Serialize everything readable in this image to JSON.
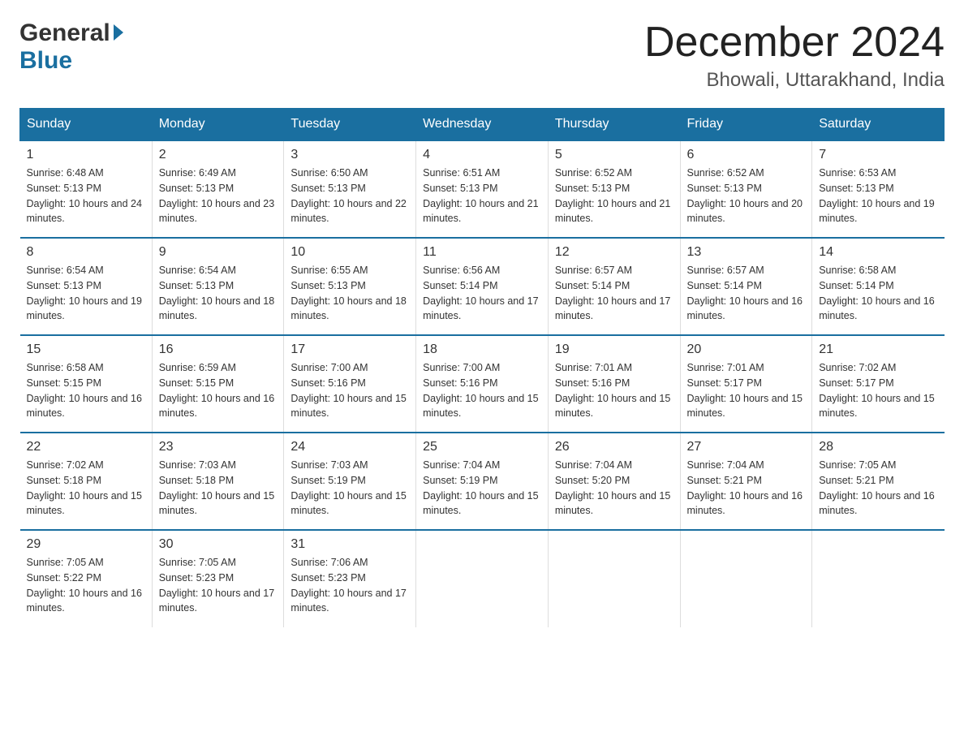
{
  "header": {
    "logo_general": "General",
    "logo_blue": "Blue",
    "month_title": "December 2024",
    "location": "Bhowali, Uttarakhand, India"
  },
  "columns": [
    "Sunday",
    "Monday",
    "Tuesday",
    "Wednesday",
    "Thursday",
    "Friday",
    "Saturday"
  ],
  "weeks": [
    [
      {
        "day": "1",
        "sunrise": "Sunrise: 6:48 AM",
        "sunset": "Sunset: 5:13 PM",
        "daylight": "Daylight: 10 hours and 24 minutes."
      },
      {
        "day": "2",
        "sunrise": "Sunrise: 6:49 AM",
        "sunset": "Sunset: 5:13 PM",
        "daylight": "Daylight: 10 hours and 23 minutes."
      },
      {
        "day": "3",
        "sunrise": "Sunrise: 6:50 AM",
        "sunset": "Sunset: 5:13 PM",
        "daylight": "Daylight: 10 hours and 22 minutes."
      },
      {
        "day": "4",
        "sunrise": "Sunrise: 6:51 AM",
        "sunset": "Sunset: 5:13 PM",
        "daylight": "Daylight: 10 hours and 21 minutes."
      },
      {
        "day": "5",
        "sunrise": "Sunrise: 6:52 AM",
        "sunset": "Sunset: 5:13 PM",
        "daylight": "Daylight: 10 hours and 21 minutes."
      },
      {
        "day": "6",
        "sunrise": "Sunrise: 6:52 AM",
        "sunset": "Sunset: 5:13 PM",
        "daylight": "Daylight: 10 hours and 20 minutes."
      },
      {
        "day": "7",
        "sunrise": "Sunrise: 6:53 AM",
        "sunset": "Sunset: 5:13 PM",
        "daylight": "Daylight: 10 hours and 19 minutes."
      }
    ],
    [
      {
        "day": "8",
        "sunrise": "Sunrise: 6:54 AM",
        "sunset": "Sunset: 5:13 PM",
        "daylight": "Daylight: 10 hours and 19 minutes."
      },
      {
        "day": "9",
        "sunrise": "Sunrise: 6:54 AM",
        "sunset": "Sunset: 5:13 PM",
        "daylight": "Daylight: 10 hours and 18 minutes."
      },
      {
        "day": "10",
        "sunrise": "Sunrise: 6:55 AM",
        "sunset": "Sunset: 5:13 PM",
        "daylight": "Daylight: 10 hours and 18 minutes."
      },
      {
        "day": "11",
        "sunrise": "Sunrise: 6:56 AM",
        "sunset": "Sunset: 5:14 PM",
        "daylight": "Daylight: 10 hours and 17 minutes."
      },
      {
        "day": "12",
        "sunrise": "Sunrise: 6:57 AM",
        "sunset": "Sunset: 5:14 PM",
        "daylight": "Daylight: 10 hours and 17 minutes."
      },
      {
        "day": "13",
        "sunrise": "Sunrise: 6:57 AM",
        "sunset": "Sunset: 5:14 PM",
        "daylight": "Daylight: 10 hours and 16 minutes."
      },
      {
        "day": "14",
        "sunrise": "Sunrise: 6:58 AM",
        "sunset": "Sunset: 5:14 PM",
        "daylight": "Daylight: 10 hours and 16 minutes."
      }
    ],
    [
      {
        "day": "15",
        "sunrise": "Sunrise: 6:58 AM",
        "sunset": "Sunset: 5:15 PM",
        "daylight": "Daylight: 10 hours and 16 minutes."
      },
      {
        "day": "16",
        "sunrise": "Sunrise: 6:59 AM",
        "sunset": "Sunset: 5:15 PM",
        "daylight": "Daylight: 10 hours and 16 minutes."
      },
      {
        "day": "17",
        "sunrise": "Sunrise: 7:00 AM",
        "sunset": "Sunset: 5:16 PM",
        "daylight": "Daylight: 10 hours and 15 minutes."
      },
      {
        "day": "18",
        "sunrise": "Sunrise: 7:00 AM",
        "sunset": "Sunset: 5:16 PM",
        "daylight": "Daylight: 10 hours and 15 minutes."
      },
      {
        "day": "19",
        "sunrise": "Sunrise: 7:01 AM",
        "sunset": "Sunset: 5:16 PM",
        "daylight": "Daylight: 10 hours and 15 minutes."
      },
      {
        "day": "20",
        "sunrise": "Sunrise: 7:01 AM",
        "sunset": "Sunset: 5:17 PM",
        "daylight": "Daylight: 10 hours and 15 minutes."
      },
      {
        "day": "21",
        "sunrise": "Sunrise: 7:02 AM",
        "sunset": "Sunset: 5:17 PM",
        "daylight": "Daylight: 10 hours and 15 minutes."
      }
    ],
    [
      {
        "day": "22",
        "sunrise": "Sunrise: 7:02 AM",
        "sunset": "Sunset: 5:18 PM",
        "daylight": "Daylight: 10 hours and 15 minutes."
      },
      {
        "day": "23",
        "sunrise": "Sunrise: 7:03 AM",
        "sunset": "Sunset: 5:18 PM",
        "daylight": "Daylight: 10 hours and 15 minutes."
      },
      {
        "day": "24",
        "sunrise": "Sunrise: 7:03 AM",
        "sunset": "Sunset: 5:19 PM",
        "daylight": "Daylight: 10 hours and 15 minutes."
      },
      {
        "day": "25",
        "sunrise": "Sunrise: 7:04 AM",
        "sunset": "Sunset: 5:19 PM",
        "daylight": "Daylight: 10 hours and 15 minutes."
      },
      {
        "day": "26",
        "sunrise": "Sunrise: 7:04 AM",
        "sunset": "Sunset: 5:20 PM",
        "daylight": "Daylight: 10 hours and 15 minutes."
      },
      {
        "day": "27",
        "sunrise": "Sunrise: 7:04 AM",
        "sunset": "Sunset: 5:21 PM",
        "daylight": "Daylight: 10 hours and 16 minutes."
      },
      {
        "day": "28",
        "sunrise": "Sunrise: 7:05 AM",
        "sunset": "Sunset: 5:21 PM",
        "daylight": "Daylight: 10 hours and 16 minutes."
      }
    ],
    [
      {
        "day": "29",
        "sunrise": "Sunrise: 7:05 AM",
        "sunset": "Sunset: 5:22 PM",
        "daylight": "Daylight: 10 hours and 16 minutes."
      },
      {
        "day": "30",
        "sunrise": "Sunrise: 7:05 AM",
        "sunset": "Sunset: 5:23 PM",
        "daylight": "Daylight: 10 hours and 17 minutes."
      },
      {
        "day": "31",
        "sunrise": "Sunrise: 7:06 AM",
        "sunset": "Sunset: 5:23 PM",
        "daylight": "Daylight: 10 hours and 17 minutes."
      },
      null,
      null,
      null,
      null
    ]
  ]
}
